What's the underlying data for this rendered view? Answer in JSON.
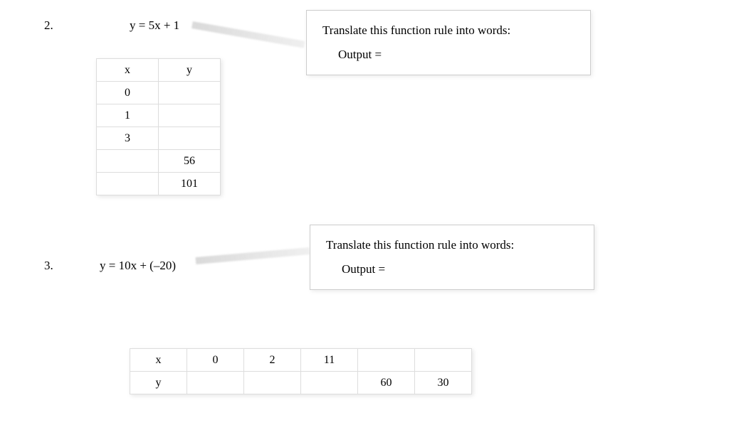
{
  "problems": [
    {
      "number": "2.",
      "equation": "y = 5x + 1",
      "callout": {
        "title": "Translate this function rule into words:",
        "output_label": "Output ="
      },
      "table": {
        "orientation": "vertical",
        "headers": [
          "x",
          "y"
        ],
        "rows": [
          [
            "0",
            ""
          ],
          [
            "1",
            ""
          ],
          [
            "3",
            ""
          ],
          [
            "",
            "56"
          ],
          [
            "",
            "101"
          ]
        ]
      }
    },
    {
      "number": "3.",
      "equation": "y = 10x + (‒20)",
      "callout": {
        "title": "Translate this function rule into words:",
        "output_label": "Output ="
      },
      "table": {
        "orientation": "horizontal",
        "headers": [
          "x",
          "y"
        ],
        "rows": [
          [
            "0",
            ""
          ],
          [
            "2",
            ""
          ],
          [
            "11",
            ""
          ],
          [
            "",
            "60"
          ],
          [
            "",
            "30"
          ]
        ]
      }
    }
  ]
}
